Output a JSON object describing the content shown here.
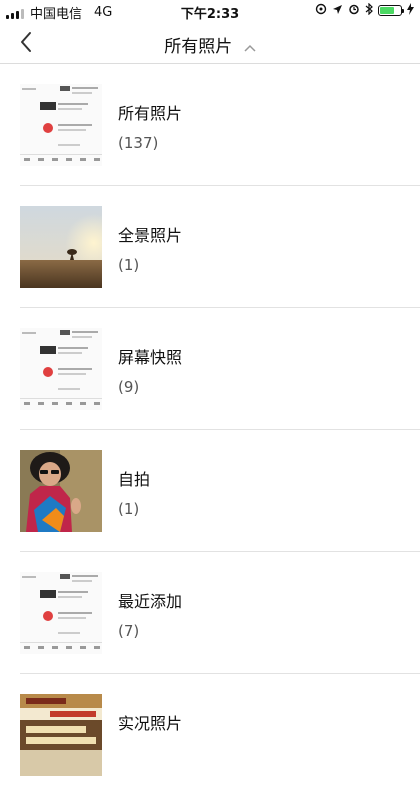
{
  "status_bar": {
    "carrier": "中国电信",
    "network": "4G",
    "time": "下午2:33",
    "battery_level": 0.7
  },
  "nav": {
    "title": "所有照片",
    "back_icon": "chevron-left-icon",
    "title_icon": "chevron-up-icon"
  },
  "albums": [
    {
      "name": "所有照片",
      "count": "(137)",
      "thumb": "screenshot"
    },
    {
      "name": "全景照片",
      "count": "(1)",
      "thumb": "panorama"
    },
    {
      "name": "屏幕快照",
      "count": "(9)",
      "thumb": "screenshot"
    },
    {
      "name": "自拍",
      "count": "(1)",
      "thumb": "portrait"
    },
    {
      "name": "最近添加",
      "count": "(7)",
      "thumb": "screenshot"
    },
    {
      "name": "实况照片",
      "count": "",
      "thumb": "document"
    }
  ],
  "colors": {
    "divider": "#e2e2e2",
    "battery": "#4cd964",
    "count_text": "#555555"
  }
}
